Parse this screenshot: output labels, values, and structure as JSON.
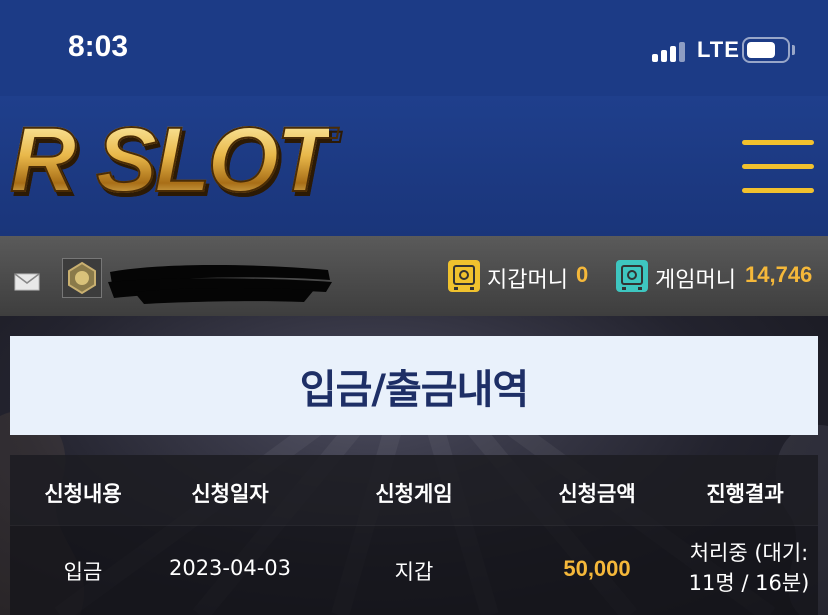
{
  "status_bar": {
    "time": "8:03",
    "network": "LTE",
    "icons": [
      "signal-icon",
      "battery-icon"
    ]
  },
  "header": {
    "logo_text": "R SLOT",
    "menu_icon": "hamburger-menu-icon",
    "colors": {
      "background": "#1f3f8c",
      "menu": "#f2c12e",
      "logo_gold": "#e9b84a"
    }
  },
  "user_bar": {
    "icons": [
      "mail-icon",
      "rank-badge-icon"
    ],
    "wallet": {
      "label": "지갑머니",
      "value": "0",
      "icon": "wallet-safe-icon"
    },
    "game": {
      "label": "게임머니",
      "value": "14,746",
      "icon": "game-safe-icon"
    },
    "colors": {
      "value": "#f5b83a",
      "wallet_icon": "#f0c22e",
      "game_icon": "#3ec6c0"
    }
  },
  "page": {
    "title": "입금/출금내역",
    "title_color": "#1e2f66"
  },
  "table": {
    "headers": [
      "신청내용",
      "신청일자",
      "신청게임",
      "신청금액",
      "진행결과"
    ],
    "rows": [
      {
        "type": "입금",
        "date": "2023-04-03",
        "game": "지갑",
        "amount": "50,000",
        "result_line1": "처리중 (대기:",
        "result_line2": "11명 / 16분)"
      }
    ]
  }
}
